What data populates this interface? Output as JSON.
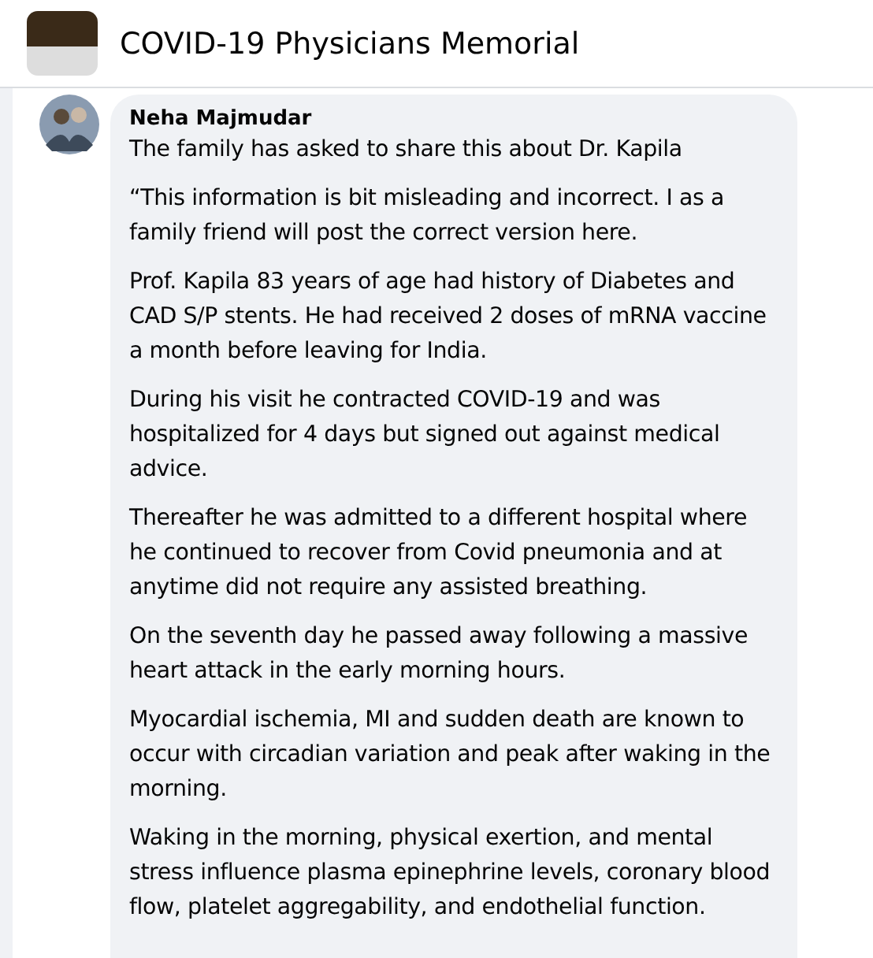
{
  "page": {
    "title": "COVID-19 Physicians Memorial"
  },
  "comment": {
    "author": "Neha Majmudar",
    "paragraphs": [
      "The family has asked to share this about Dr. Kapila",
      "“This information is bit misleading and incorrect. I as a family friend will post the correct version here.",
      "Prof. Kapila 83 years of age had history of Diabetes and CAD S/P stents. He had received 2 doses of mRNA vaccine a month before leaving for India.",
      "During his visit he contracted COVID-19 and was hospitalized for 4 days but signed out against medical advice.",
      "Thereafter he was admitted to a different hospital where he continued to recover from Covid pneumonia and at anytime did not require any assisted breathing.",
      "On the seventh day he passed away following a massive heart attack in the early morning hours.",
      "Myocardial ischemia, MI and sudden death are known to occur with circadian variation and peak after waking in the morning.",
      "Waking in the morning, physical exertion, and mental stress influence plasma epinephrine levels, coronary blood flow, platelet aggregability, and endothelial function."
    ]
  }
}
